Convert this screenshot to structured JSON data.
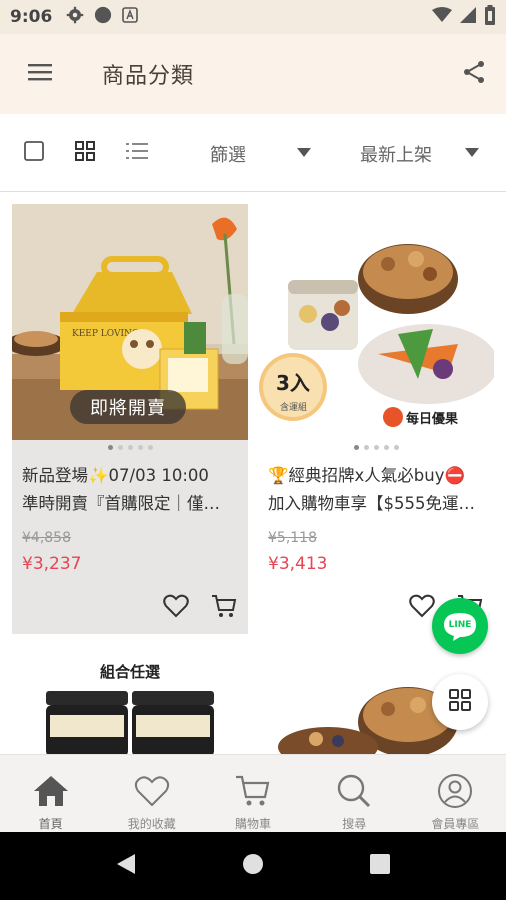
{
  "status_bar": {
    "time": "9:06"
  },
  "header": {
    "title": "商品分類"
  },
  "toolbar": {
    "filter_label": "篩選",
    "sort_label": "最新上架"
  },
  "products": [
    {
      "title_line1": "新品登場✨07/03 10:00",
      "title_line2": "準時開賣『首購限定｜僅…",
      "original_price": "¥4,858",
      "sale_price": "¥3,237",
      "badge": "即將開賣",
      "box_text": "KEEP LOVING"
    },
    {
      "title_line1": "🏆經典招牌x人氣必buy⛔",
      "title_line2": "加入購物車享【$555免運…",
      "original_price": "¥5,118",
      "sale_price": "¥3,413",
      "badge_number": "3入",
      "badge_sub": "含運組",
      "brand_logo": "每日優果"
    },
    {
      "label": "組合任選"
    },
    {}
  ],
  "floating": {
    "line_label": "LINE"
  },
  "bottom_nav": [
    {
      "label": "首頁",
      "icon": "home-icon"
    },
    {
      "label": "我的收藏",
      "icon": "heart-icon"
    },
    {
      "label": "購物車",
      "icon": "cart-icon"
    },
    {
      "label": "搜尋",
      "icon": "search-icon"
    },
    {
      "label": "會員專區",
      "icon": "user-icon"
    }
  ],
  "colors": {
    "accent_price": "#e64552",
    "header_bg": "#fbf2e9",
    "line_green": "#06c755"
  }
}
